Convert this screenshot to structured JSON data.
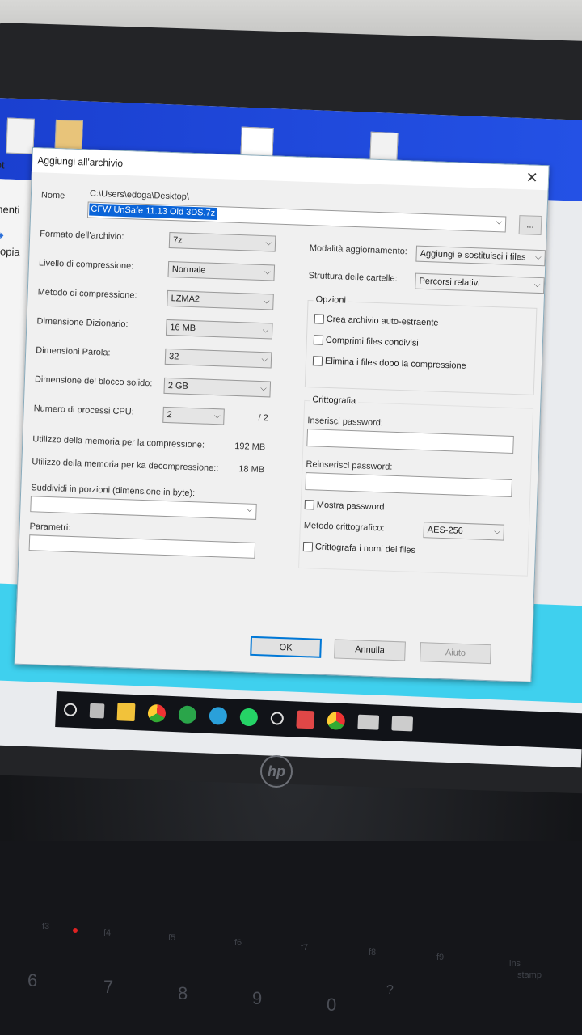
{
  "dialog": {
    "title": "Aggiungi all'archivio",
    "name_label": "Nome",
    "path": "C:\\Users\\edoga\\Desktop\\",
    "filename": "CFW UnSafe 11.13 Old 3DS.7z",
    "browse_label": "...",
    "format_label": "Formato dell'archivio:",
    "format_value": "7z",
    "level_label": "Livello di compressione:",
    "level_value": "Normale",
    "method_label": "Metodo di compressione:",
    "method_value": "LZMA2",
    "dict_label": "Dimensione Dizionario:",
    "dict_value": "16 MB",
    "word_label": "Dimensioni Parola:",
    "word_value": "32",
    "solid_label": "Dimensione del blocco solido:",
    "solid_value": "2 GB",
    "cpu_label": "Numero di processi CPU:",
    "cpu_value": "2",
    "cpu_total": "/ 2",
    "mem_comp_label": "Utilizzo della memoria per la compressione:",
    "mem_comp_value": "192 MB",
    "mem_decomp_label": "Utilizzo della memoria per ka decompressione::",
    "mem_decomp_value": "18 MB",
    "split_label": "Suddividi in porzioni (dimensione in byte):",
    "params_label": "Parametri:",
    "update_label": "Modalità aggiornamento:",
    "update_value": "Aggiungi e sostituisci i files",
    "paths_label": "Struttura delle cartelle:",
    "paths_value": "Percorsi relativi",
    "options_title": "Opzioni",
    "opt_sfx": "Crea archivio auto-estraente",
    "opt_shared": "Comprimi files condivisi",
    "opt_delete": "Elimina i files dopo la compressione",
    "enc_title": "Crittografia",
    "pwd_label": "Inserisci password:",
    "pwd2_label": "Reinserisci password:",
    "show_pwd": "Mostra password",
    "enc_method_label": "Metodo crittografico:",
    "enc_method_value": "AES-256",
    "enc_names": "Crittografa i nomi dei files",
    "ok": "OK",
    "cancel": "Annulla",
    "help": "Aiuto"
  },
  "desktop": {
    "strip_1": "ot",
    "strip_2": "menti",
    "strip_3": "Copia"
  },
  "laptop": {
    "brand": "hp"
  },
  "keyboard": {
    "keys": [
      "6",
      "7",
      "8",
      "9",
      "0",
      "?"
    ],
    "fn_labels": [
      "f3",
      "f4",
      "f5",
      "f6",
      "f7",
      "f8",
      "f9",
      "f10",
      "f11",
      "ins"
    ],
    "stamp": "stamp"
  }
}
